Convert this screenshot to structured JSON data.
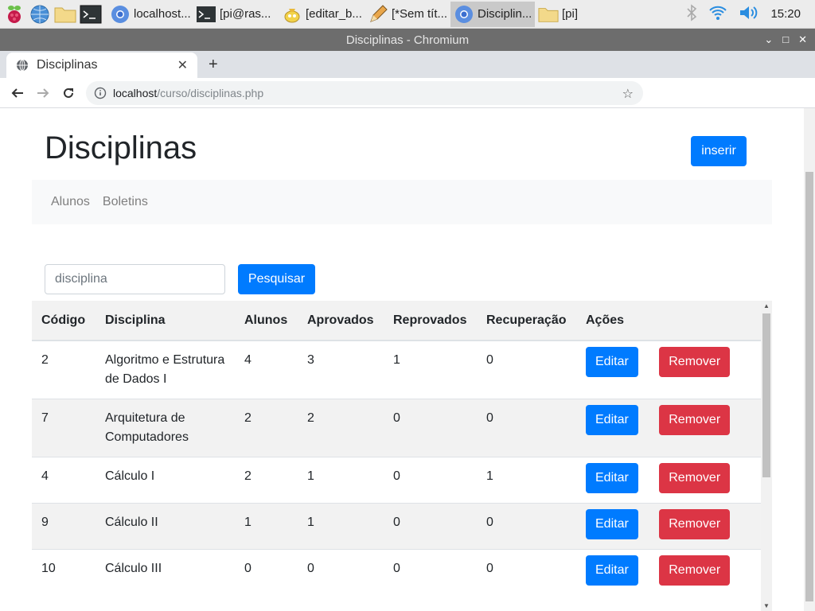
{
  "taskbar": {
    "tasks": [
      {
        "label": "localhost..."
      },
      {
        "label": "[pi@ras..."
      },
      {
        "label": "[editar_b..."
      },
      {
        "label": "[*Sem tít..."
      },
      {
        "label": "Disciplin..."
      },
      {
        "label": "[pi]"
      }
    ],
    "clock": "15:20"
  },
  "window": {
    "title": "Disciplinas - Chromium"
  },
  "browser": {
    "tab_title": "Disciplinas",
    "url_host": "localhost",
    "url_path": "/curso/disciplinas.php"
  },
  "page": {
    "title": "Disciplinas",
    "insert_button": "inserir",
    "nav": [
      {
        "label": "Alunos"
      },
      {
        "label": "Boletins"
      }
    ],
    "search": {
      "placeholder": "disciplina",
      "button": "Pesquisar"
    },
    "table": {
      "headers": [
        "Código",
        "Disciplina",
        "Alunos",
        "Aprovados",
        "Reprovados",
        "Recuperação",
        "Ações"
      ],
      "edit_label": "Editar",
      "remove_label": "Remover",
      "rows": [
        {
          "codigo": "2",
          "disciplina": "Algoritmo e Estrutura de Dados I",
          "alunos": "4",
          "aprovados": "3",
          "reprovados": "1",
          "recuperacao": "0"
        },
        {
          "codigo": "7",
          "disciplina": "Arquitetura de Computadores",
          "alunos": "2",
          "aprovados": "2",
          "reprovados": "0",
          "recuperacao": "0"
        },
        {
          "codigo": "4",
          "disciplina": "Cálculo I",
          "alunos": "2",
          "aprovados": "1",
          "reprovados": "0",
          "recuperacao": "1"
        },
        {
          "codigo": "9",
          "disciplina": "Cálculo II",
          "alunos": "1",
          "aprovados": "1",
          "reprovados": "0",
          "recuperacao": "0"
        },
        {
          "codigo": "10",
          "disciplina": "Cálculo III",
          "alunos": "0",
          "aprovados": "0",
          "reprovados": "0",
          "recuperacao": "0"
        }
      ]
    }
  },
  "colors": {
    "primary": "#007bff",
    "danger": "#dc3545",
    "navbar_bg": "#f8f9fa"
  }
}
